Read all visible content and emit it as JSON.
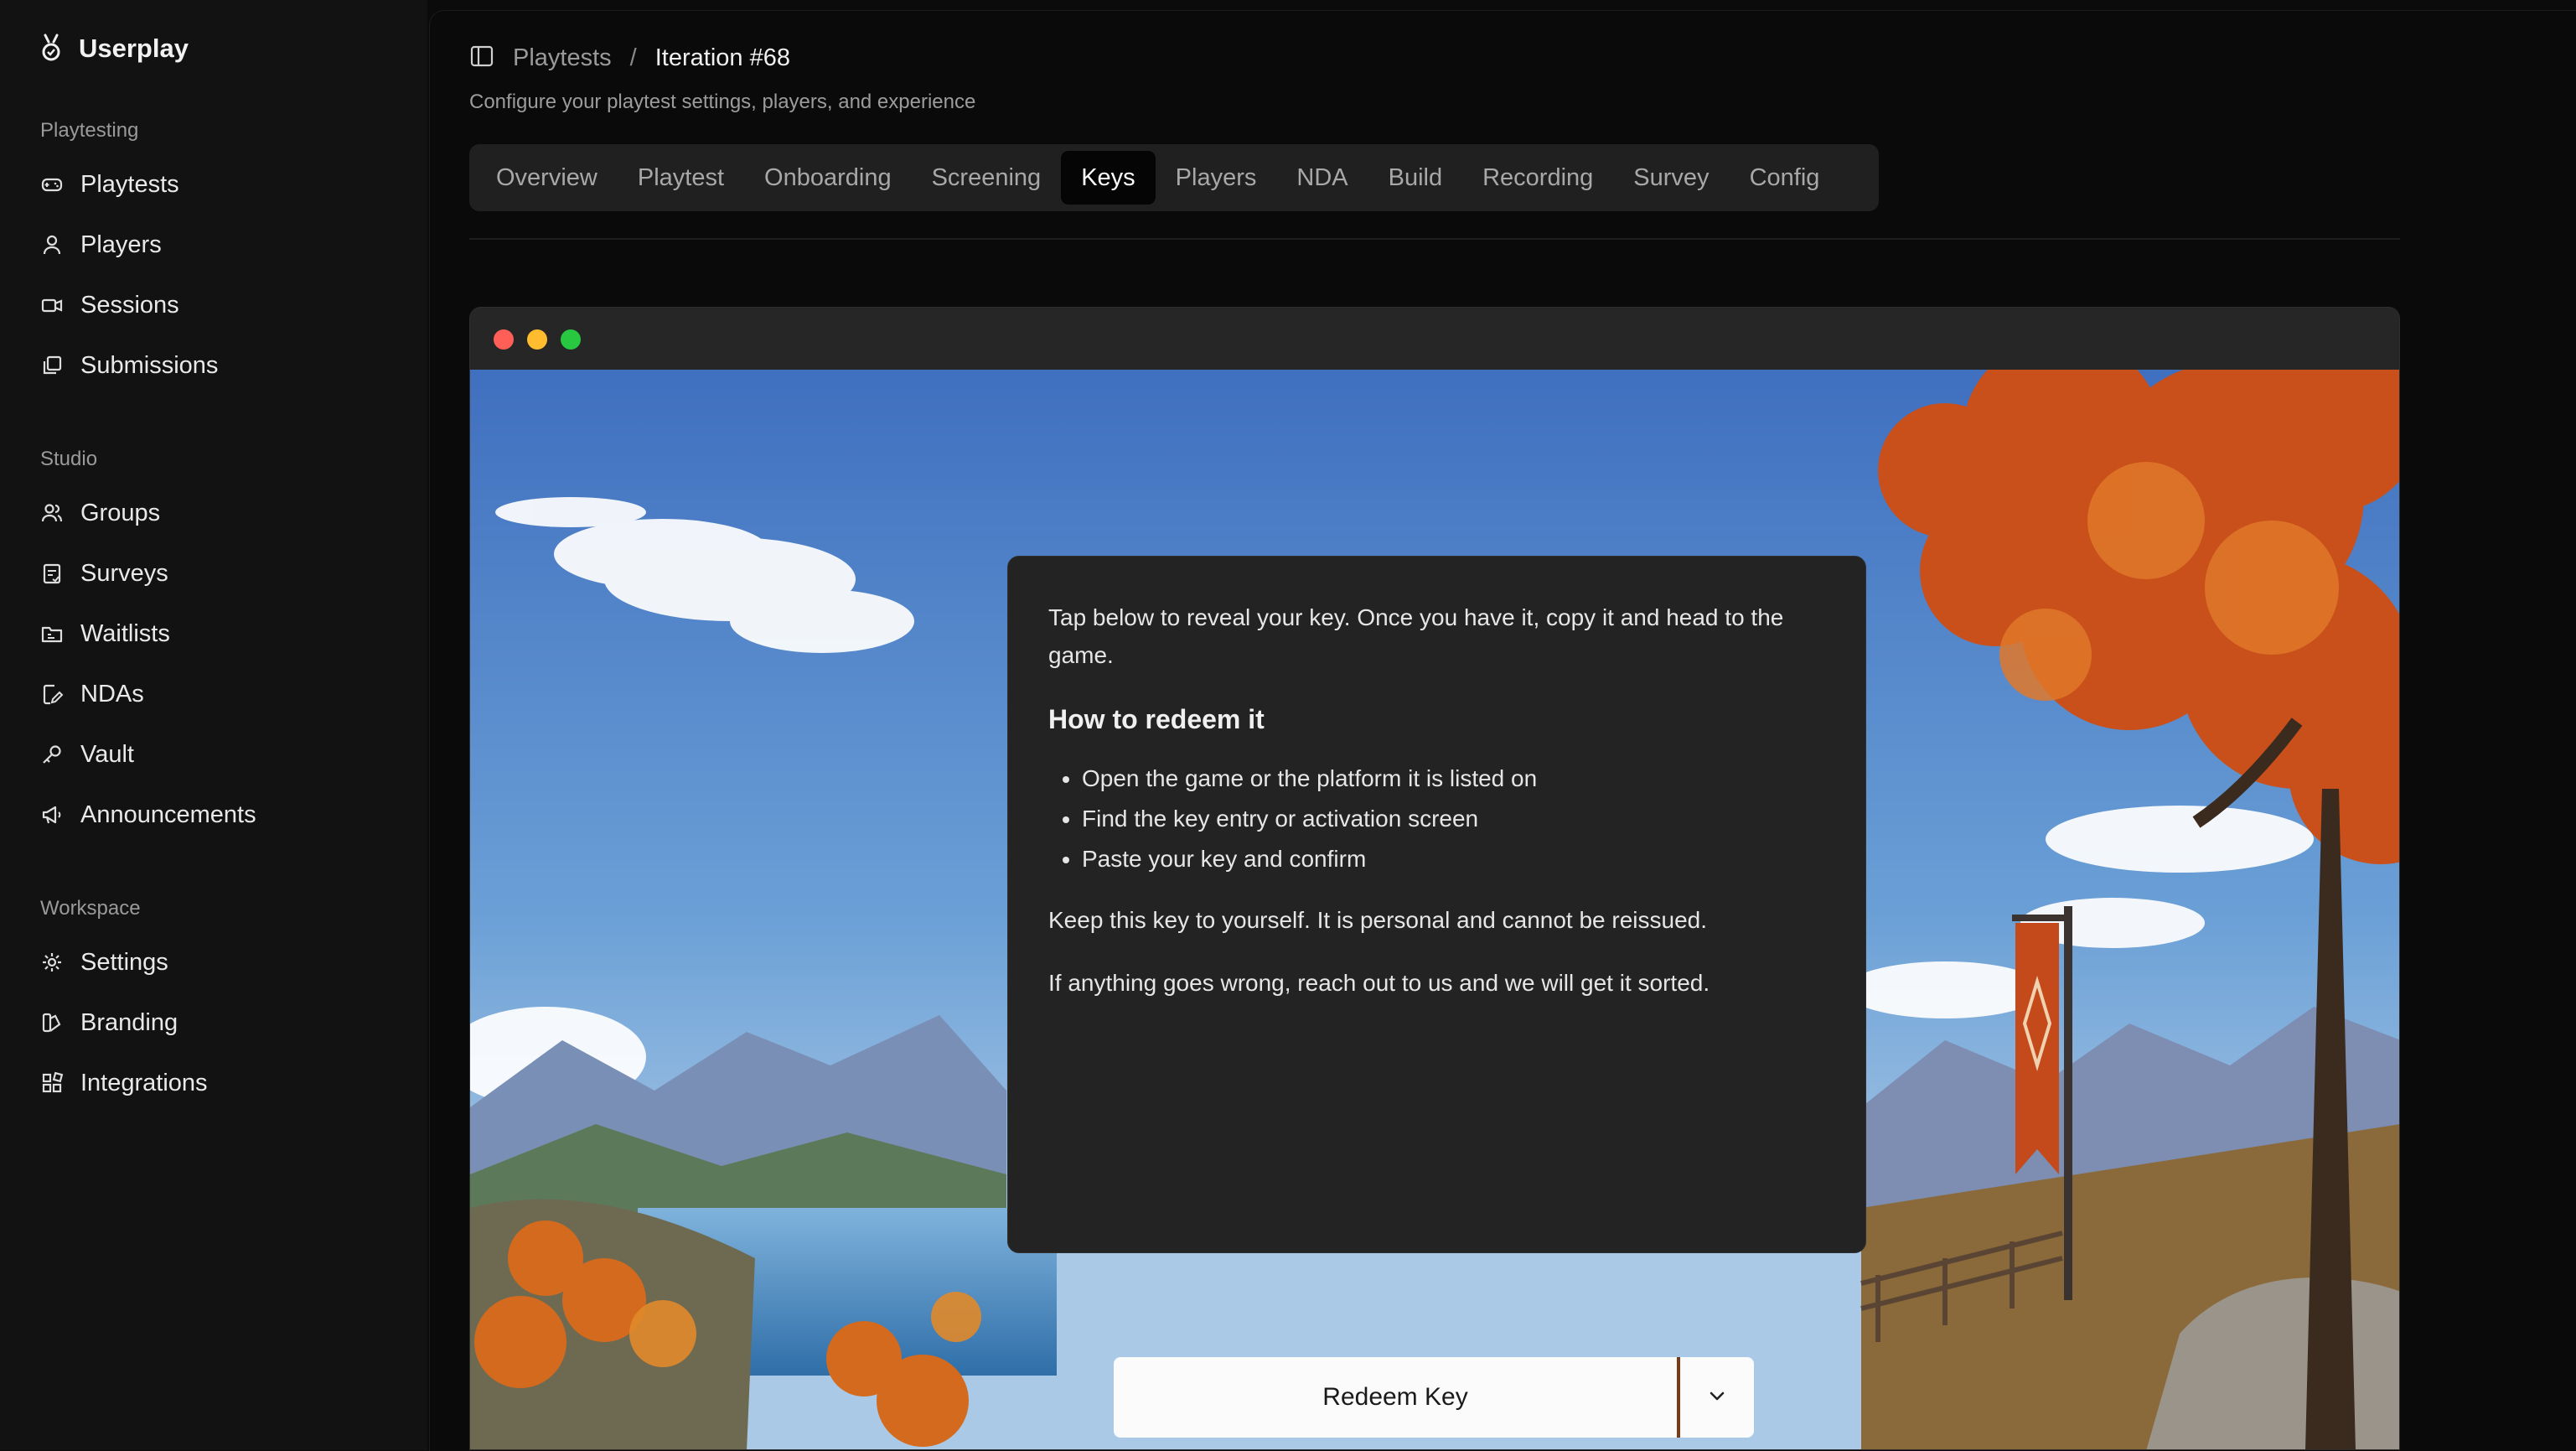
{
  "app": {
    "name": "Userplay"
  },
  "sidebar": {
    "sections": [
      {
        "label": "Playtesting",
        "items": [
          {
            "label": "Playtests",
            "icon": "gamepad-icon"
          },
          {
            "label": "Players",
            "icon": "user-icon"
          },
          {
            "label": "Sessions",
            "icon": "video-icon"
          },
          {
            "label": "Submissions",
            "icon": "copy-icon"
          }
        ]
      },
      {
        "label": "Studio",
        "items": [
          {
            "label": "Groups",
            "icon": "users-icon"
          },
          {
            "label": "Surveys",
            "icon": "survey-icon"
          },
          {
            "label": "Waitlists",
            "icon": "folder-list-icon"
          },
          {
            "label": "NDAs",
            "icon": "file-edit-icon"
          },
          {
            "label": "Vault",
            "icon": "key-icon"
          },
          {
            "label": "Announcements",
            "icon": "megaphone-icon"
          }
        ]
      },
      {
        "label": "Workspace",
        "items": [
          {
            "label": "Settings",
            "icon": "gear-icon"
          },
          {
            "label": "Branding",
            "icon": "palette-icon"
          },
          {
            "label": "Integrations",
            "icon": "blocks-icon"
          }
        ]
      }
    ]
  },
  "header": {
    "breadcrumb_parent": "Playtests",
    "breadcrumb_sep": "/",
    "breadcrumb_current": "Iteration #68",
    "subtitle": "Configure your playtest settings, players, and experience"
  },
  "tabs": [
    {
      "label": "Overview"
    },
    {
      "label": "Playtest"
    },
    {
      "label": "Onboarding"
    },
    {
      "label": "Screening"
    },
    {
      "label": "Keys",
      "active": true
    },
    {
      "label": "Players"
    },
    {
      "label": "NDA"
    },
    {
      "label": "Build"
    },
    {
      "label": "Recording"
    },
    {
      "label": "Survey"
    },
    {
      "label": "Config"
    }
  ],
  "preview": {
    "intro": "Tap below to reveal your key. Once you have it, copy it and head to the game.",
    "heading": "How to redeem it",
    "steps": [
      "Open the game or the platform it is listed on",
      "Find the key entry or activation screen",
      "Paste your key and confirm"
    ],
    "note": "Keep this key to yourself. It is personal and cannot be reissued.",
    "help": "If anything goes wrong, reach out to us and we will get it sorted.",
    "button_label": "Redeem Key"
  },
  "colors": {
    "sidebar_bg": "#121212",
    "main_bg": "#0a0a0a",
    "tab_bar_bg": "#202020",
    "traffic_red": "#ff5f57",
    "traffic_yellow": "#febc2e",
    "traffic_green": "#28c840"
  }
}
